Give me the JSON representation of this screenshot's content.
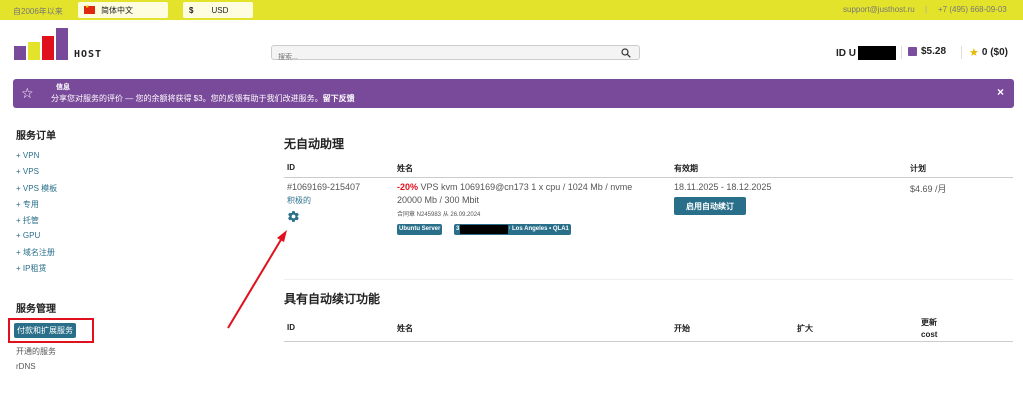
{
  "topbar": {
    "since": "自2006年以来",
    "language": "简体中文",
    "currency_symbol": "$",
    "currency": "USD",
    "email": "support@justhost.ru",
    "separator": "|",
    "phone": "+7 (495) 668-09-03"
  },
  "logo": {
    "text": "HOST"
  },
  "search": {
    "placeholder": "搜索..."
  },
  "account": {
    "id_label": "ID U",
    "balance": "$5.28",
    "bonus": "0 ($0)"
  },
  "banner": {
    "title": "信息",
    "text": "分享您对服务的评价 — 您的余额将获得 $3。您的反馈有助于我们改进服务。",
    "link": "留下反馈",
    "close": "×"
  },
  "sidebar": {
    "orders_heading": "服务订单",
    "orders": [
      "+ VPN",
      "+ VPS",
      "+ VPS 模板",
      "+ 专用",
      "+ 托管",
      "+ GPU",
      "+ 域名注册",
      "+ IP租赁"
    ],
    "manage_heading": "服务管理",
    "active_item": "付款和扩展服务",
    "manage_items": [
      "开通的服务",
      "rDNS"
    ]
  },
  "no_auto": {
    "heading": "无自动助理",
    "columns": {
      "id": "ID",
      "name": "姓名",
      "validity": "有效期",
      "plan": "计划"
    },
    "row": {
      "id": "#1069169-215407",
      "status": "积极的",
      "discount": "-20%",
      "name": "VPS kvm 1069169@cn173 1 x cpu / 1024 Mb / nvme",
      "name2": "20000 Mb / 300 Mbit",
      "contract": "合同章 N245983 从 26.09.2024",
      "validity": "18.11.2025 - 18.12.2025",
      "renew_button": "启用自动续订",
      "price": "$4.69 /月",
      "badges": [
        "Ubuntu Server",
        "3",
        "0",
        "Los Angeles • QLA1"
      ]
    }
  },
  "auto": {
    "heading": "具有自动续订功能",
    "columns": {
      "id": "ID",
      "name": "姓名",
      "start": "开始",
      "extend": "扩大",
      "update1": "更新",
      "update2": "cost"
    }
  },
  "colors": {
    "topbar": "#e3e32b",
    "banner": "#7a4a9a",
    "accent": "#2a6f8a",
    "highlight": "#e0101c"
  }
}
